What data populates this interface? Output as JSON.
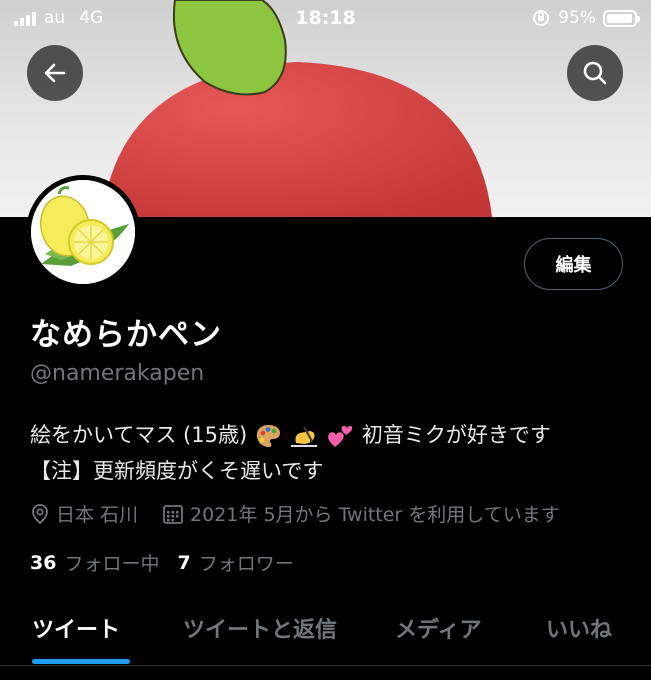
{
  "status_bar": {
    "carrier": "au",
    "network": "4G",
    "time": "18:18",
    "battery": "95%",
    "battery_level": 0.95
  },
  "profile": {
    "display_name": "なめらかペン",
    "handle": "@namerakapen",
    "bio_line1_a": "絵をかいてマス (15歳)",
    "bio_line1_b": "初音ミクが好きです",
    "bio_line2": "【注】更新頻度がくそ遅いです",
    "location": "日本 石川",
    "joined": "2021年 5月から Twitter を利用しています",
    "following_count": "36",
    "following_label": "フォロー中",
    "followers_count": "7",
    "followers_label": "フォロワー"
  },
  "edit_button_label": "編集",
  "tabs": [
    {
      "label": "ツイート",
      "active": true
    },
    {
      "label": "ツイートと返信",
      "active": false
    },
    {
      "label": "メディア",
      "active": false
    },
    {
      "label": "いいね",
      "active": false
    }
  ],
  "icons": [
    "back-arrow-icon",
    "search-icon",
    "location-pin-icon",
    "calendar-icon",
    "palette-emoji",
    "writing-hand-emoji",
    "two-hearts-emoji",
    "lemon-avatar"
  ],
  "colors": {
    "background": "#000000",
    "accent": "#1d9bf0",
    "secondary_text": "#71767b",
    "apple_red": "#d94040",
    "leaf_green": "#8cc63f"
  }
}
